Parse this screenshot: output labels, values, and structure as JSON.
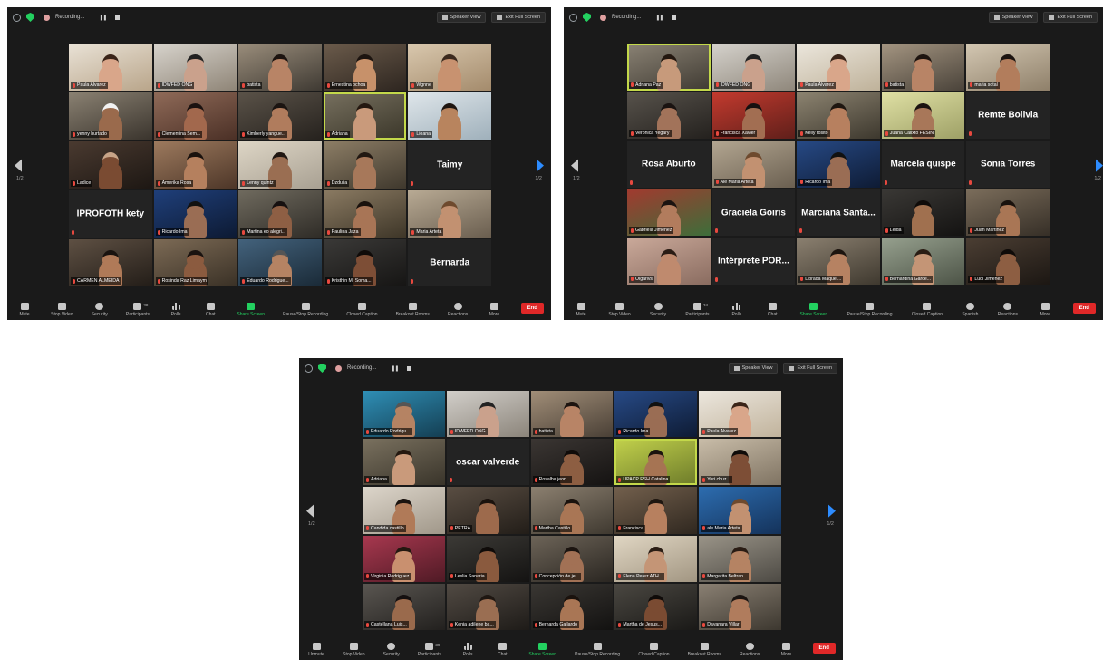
{
  "recording_label": "Recording...",
  "speaker_view_label": "Speaker View",
  "exit_fullscreen_label": "Exit Full Screen",
  "end_label": "End",
  "windows": [
    {
      "page_left": "1/2",
      "page_right": "1/2",
      "tiles": [
        {
          "type": "video",
          "name": "Paula Alvarez",
          "c1": "#e9e2d6",
          "c2": "#b9a58a",
          "skin": "#d9a68a",
          "hair": "#3a2418"
        },
        {
          "type": "video",
          "name": "IDWFED ONG",
          "c1": "#d7d3cc",
          "c2": "#8f8577",
          "skin": "#caa18c",
          "hair": "#222"
        },
        {
          "type": "video",
          "name": "batista",
          "c1": "#9a8d7b",
          "c2": "#3f3a33",
          "skin": "#b88466",
          "hair": "#1d1410"
        },
        {
          "type": "video",
          "name": "Ernestina ochoa",
          "c1": "#6b5b4b",
          "c2": "#2e2620",
          "skin": "#c7916a",
          "hair": "#1c1410"
        },
        {
          "type": "video",
          "name": "Wgnne",
          "c1": "#d9c8ae",
          "c2": "#a48b6c",
          "skin": "#c89270",
          "hair": "#3c2a1e"
        },
        {
          "type": "video",
          "name": "yenny hurtado",
          "c1": "#8a8172",
          "c2": "#3a342d",
          "skin": "#9a6a4c",
          "hair": "#f2f2f2"
        },
        {
          "type": "video",
          "name": "Clementina Sem...",
          "c1": "#8f6a58",
          "c2": "#4b3026",
          "skin": "#a2684d",
          "hair": "#1b1210"
        },
        {
          "type": "video",
          "name": "Kimberly yangue...",
          "c1": "#5a5248",
          "c2": "#26221e",
          "skin": "#b07c5d",
          "hair": "#1b1411"
        },
        {
          "type": "video",
          "name": "Adriana",
          "c1": "#77705f",
          "c2": "#3a3629",
          "skin": "#c99a7b",
          "hair": "#241810",
          "speaking": true
        },
        {
          "type": "video",
          "name": "Lioana",
          "c1": "#dfe6ea",
          "c2": "#9fb0bb",
          "skin": "#b8845e",
          "hair": "#1e1510"
        },
        {
          "type": "video",
          "name": "Ladice",
          "c1": "#4a3a30",
          "c2": "#1d1713",
          "skin": "#7a4b32",
          "hair": "#c7a488"
        },
        {
          "type": "video",
          "name": "Amerika Rosa",
          "c1": "#9d7a5e",
          "c2": "#4d3628",
          "skin": "#b5805e",
          "hair": "#1a120e"
        },
        {
          "type": "video",
          "name": "Lenny quintz",
          "c1": "#ded6c6",
          "c2": "#a8a092",
          "skin": "#9a6e52",
          "hair": "#1f1712"
        },
        {
          "type": "video",
          "name": "Dzdulia",
          "c1": "#8d7e66",
          "c2": "#3f382d",
          "skin": "#a7785a",
          "hair": "#211812"
        },
        {
          "type": "blank",
          "big": "Taimy",
          "name": ""
        },
        {
          "type": "blank",
          "big": "IPROFOTH kety",
          "name": ""
        },
        {
          "type": "video",
          "name": "Ricardo Ima",
          "c1": "#1f3f7a",
          "c2": "#0d1a33",
          "skin": "#9a6d54",
          "hair": "#111"
        },
        {
          "type": "video",
          "name": "Martina eo alegri...",
          "c1": "#6f6a5e",
          "c2": "#2f2c27",
          "skin": "#8e5f44",
          "hair": "#161010"
        },
        {
          "type": "video",
          "name": "Paulina Jaza",
          "c1": "#8a7a62",
          "c2": "#3e3628",
          "skin": "#a87556",
          "hair": "#1a120d"
        },
        {
          "type": "video",
          "name": "Maria Arteta",
          "c1": "#b8aa94",
          "c2": "#6a5e4f",
          "skin": "#c29171",
          "hair": "#6e4a2e"
        },
        {
          "type": "video",
          "name": "CARMEN ALMEIDA",
          "c1": "#5e5043",
          "c2": "#231d18",
          "skin": "#b07a58",
          "hair": "#1a130f"
        },
        {
          "type": "video",
          "name": "Rosinda Raz Limaym",
          "c1": "#7c6a55",
          "c2": "#3a3126",
          "skin": "#8b5b3f",
          "hair": "#1a1310"
        },
        {
          "type": "video",
          "name": "Eduardo Rodrigue...",
          "c1": "#43627c",
          "c2": "#1a2a37",
          "skin": "#b58363",
          "hair": "#555"
        },
        {
          "type": "video",
          "name": "Kristhin M. Soma...",
          "c1": "#3a3937",
          "c2": "#161514",
          "skin": "#7d4e36",
          "hair": "#0f0b09"
        },
        {
          "type": "blank",
          "big": "Bernarda",
          "name": ""
        }
      ],
      "toolbar": [
        {
          "label": "Mute",
          "icon": "mic-icon"
        },
        {
          "label": "Stop Video",
          "icon": "camera-icon"
        },
        {
          "label": "Security",
          "icon": "shield-icon"
        },
        {
          "label": "Participants",
          "icon": "participants-icon",
          "count": "38"
        },
        {
          "label": "Polls",
          "icon": "polls-icon"
        },
        {
          "label": "Chat",
          "icon": "chat-icon"
        },
        {
          "label": "Share Screen",
          "icon": "share-screen-icon",
          "accent": true
        },
        {
          "label": "Pause/Stop Recording",
          "icon": "pause-stop-icon"
        },
        {
          "label": "Closed Caption",
          "icon": "cc-icon"
        },
        {
          "label": "Breakout Rooms",
          "icon": "breakout-icon"
        },
        {
          "label": "Reactions",
          "icon": "reactions-icon"
        },
        {
          "label": "More",
          "icon": "more-icon"
        }
      ]
    },
    {
      "page_left": "1/2",
      "page_right": "1/2",
      "tiles": [
        {
          "type": "video",
          "name": "Adriana Paz",
          "c1": "#8a8274",
          "c2": "#3f3a32",
          "skin": "#c79a7b",
          "hair": "#23170f",
          "speaking": true
        },
        {
          "type": "video",
          "name": "IDWFED ONG",
          "c1": "#d5d2cc",
          "c2": "#8f877b",
          "skin": "#caa18c",
          "hair": "#222"
        },
        {
          "type": "video",
          "name": "Paula Alvarez",
          "c1": "#ebe6dc",
          "c2": "#bfb29a",
          "skin": "#d9a68a",
          "hair": "#3a2418"
        },
        {
          "type": "video",
          "name": "batista",
          "c1": "#a49581",
          "c2": "#4a433a",
          "skin": "#b88466",
          "hair": "#1d1410"
        },
        {
          "type": "video",
          "name": "maria sotal",
          "c1": "#d3c7b2",
          "c2": "#8f806a",
          "skin": "#b27d5c",
          "hair": "#1c1410"
        },
        {
          "type": "video",
          "name": "Veronica Yegary",
          "c1": "#57524b",
          "c2": "#24211e",
          "skin": "#a2735a",
          "hair": "#1a1311"
        },
        {
          "type": "video",
          "name": "Francisca Xavier",
          "c1": "#c33a2e",
          "c2": "#5f1f1a",
          "skin": "#a26e52",
          "hair": "#151010"
        },
        {
          "type": "video",
          "name": "Kelly rosito",
          "c1": "#8c8370",
          "c2": "#3d382e",
          "skin": "#b7805f",
          "hair": "#1e1610"
        },
        {
          "type": "video",
          "name": "Juana Calixto FESIN",
          "c1": "#dfe0a4",
          "c2": "#9ea066",
          "skin": "#a87759",
          "hair": "#1b1310"
        },
        {
          "type": "blank",
          "big": "Remte Bolivia",
          "name": ""
        },
        {
          "type": "blank",
          "big": "Rosa Aburto",
          "name": ""
        },
        {
          "type": "video",
          "name": "Ale Maria Arteta",
          "c1": "#b4a792",
          "c2": "#6a5f50",
          "skin": "#c29171",
          "hair": "#6e4a2e"
        },
        {
          "type": "video",
          "name": "Ricardo Ima",
          "c1": "#274a86",
          "c2": "#0e1b34",
          "skin": "#9a6d54",
          "hair": "#111"
        },
        {
          "type": "blank",
          "big": "Marcela quispe",
          "name": ""
        },
        {
          "type": "blank",
          "big": "Sonia Torres",
          "name": ""
        },
        {
          "type": "video",
          "name": "Gabriela Jimenez",
          "c1": "#a13a2f",
          "c2": "#3d6e3a",
          "skin": "#b27c5d",
          "hair": "#1b1310"
        },
        {
          "type": "blank",
          "big": "Graciela Goiris",
          "name": ""
        },
        {
          "type": "blank",
          "big": "Marciana Santa...",
          "name": ""
        },
        {
          "type": "video",
          "name": "Leida",
          "c1": "#3a3835",
          "c2": "#141312",
          "skin": "#a0704f",
          "hair": "#0f0b09"
        },
        {
          "type": "video",
          "name": "Juan Martinez",
          "c1": "#7b6d5b",
          "c2": "#362f27",
          "skin": "#a97655",
          "hair": "#1a120d"
        },
        {
          "type": "video",
          "name": "Olgarivs",
          "c1": "#caa99a",
          "c2": "#8a6c60",
          "skin": "#bf8a6e",
          "hair": "#2a1c14"
        },
        {
          "type": "blank",
          "big": "Intérprete POR...",
          "name": ""
        },
        {
          "type": "video",
          "name": "Librada Maquel...",
          "c1": "#8b8070",
          "c2": "#3f392f",
          "skin": "#b68262",
          "hair": "#1c140f"
        },
        {
          "type": "video",
          "name": "Bernardina Garce...",
          "c1": "#96a08e",
          "c2": "#4d5447",
          "skin": "#c49576",
          "hair": "#2a1d14"
        },
        {
          "type": "video",
          "name": "Ludi Jimenez",
          "c1": "#4b3e33",
          "c2": "#1c1713",
          "skin": "#8d5e42",
          "hair": "#0f0b09"
        }
      ],
      "toolbar": [
        {
          "label": "Mute",
          "icon": "mic-icon"
        },
        {
          "label": "Stop Video",
          "icon": "camera-icon"
        },
        {
          "label": "Security",
          "icon": "shield-icon"
        },
        {
          "label": "Participants",
          "icon": "participants-icon",
          "count": "34"
        },
        {
          "label": "Polls",
          "icon": "polls-icon"
        },
        {
          "label": "Chat",
          "icon": "chat-icon"
        },
        {
          "label": "Share Screen",
          "icon": "share-screen-icon",
          "accent": true
        },
        {
          "label": "Pause/Stop Recording",
          "icon": "pause-stop-icon"
        },
        {
          "label": "Closed Caption",
          "icon": "cc-icon"
        },
        {
          "label": "Spanish",
          "icon": "language-icon"
        },
        {
          "label": "Reactions",
          "icon": "reactions-icon"
        },
        {
          "label": "More",
          "icon": "more-icon"
        }
      ]
    },
    {
      "page_left": "1/2",
      "page_right": "1/2",
      "tiles": [
        {
          "type": "video",
          "name": "Eduardo Rodrigu...",
          "c1": "#2f8fb6",
          "c2": "#143e52",
          "skin": "#b58363",
          "hair": "#555"
        },
        {
          "type": "video",
          "name": "IDWFED ONG",
          "c1": "#d2cfca",
          "c2": "#8b847a",
          "skin": "#caa18c",
          "hair": "#222"
        },
        {
          "type": "video",
          "name": "batista",
          "c1": "#a18e78",
          "c2": "#4a4036",
          "skin": "#b88466",
          "hair": "#1d1410"
        },
        {
          "type": "video",
          "name": "Ricardo Ima",
          "c1": "#274a86",
          "c2": "#0e1b34",
          "skin": "#9a6d54",
          "hair": "#111"
        },
        {
          "type": "video",
          "name": "Paula Alvarez",
          "c1": "#ece7de",
          "c2": "#c1b39c",
          "skin": "#d9a68a",
          "hair": "#3a2418"
        },
        {
          "type": "video",
          "name": "Adriana",
          "c1": "#7a715f",
          "c2": "#39342a",
          "skin": "#c99a7b",
          "hair": "#241810"
        },
        {
          "type": "blank",
          "big": "oscar valverde",
          "name": ""
        },
        {
          "type": "video",
          "name": "Rosalba jeon...",
          "c1": "#3b3633",
          "c2": "#151312",
          "skin": "#8d5e42",
          "hair": "#0f0b09"
        },
        {
          "type": "video",
          "name": "UPACP ESH Catalina",
          "c1": "#c3d24c",
          "c2": "#6d7b2a",
          "skin": "#a67453",
          "hair": "#1b130e",
          "speaking": true
        },
        {
          "type": "video",
          "name": "Yuri chuz...",
          "c1": "#c9bda9",
          "c2": "#7f7362",
          "skin": "#7d4e36",
          "hair": "#0f0b09"
        },
        {
          "type": "video",
          "name": "Candida castillo",
          "c1": "#ddd6cb",
          "c2": "#a09789",
          "skin": "#b07a58",
          "hair": "#1a130f"
        },
        {
          "type": "video",
          "name": "PETRA",
          "c1": "#5a4e43",
          "c2": "#221d18",
          "skin": "#9d6a4c",
          "hair": "#1a120d"
        },
        {
          "type": "video",
          "name": "Martha Castillo",
          "c1": "#8c8070",
          "c2": "#3f3930",
          "skin": "#a97655",
          "hair": "#1a120d"
        },
        {
          "type": "video",
          "name": "Francisca",
          "c1": "#73604d",
          "c2": "#2f271f",
          "skin": "#b7805f",
          "hair": "#1e1610"
        },
        {
          "type": "video",
          "name": "ale Maria Arteta",
          "c1": "#2d6db0",
          "c2": "#14325a",
          "skin": "#c29171",
          "hair": "#6e4a2e"
        },
        {
          "type": "video",
          "name": "Virginia Rodriguez",
          "c1": "#a8384f",
          "c2": "#4f1a25",
          "skin": "#c9906f",
          "hair": "#241810"
        },
        {
          "type": "video",
          "name": "Leslia Sanaria",
          "c1": "#3c3a36",
          "c2": "#141312",
          "skin": "#8a5a3e",
          "hair": "#0f0b09"
        },
        {
          "type": "video",
          "name": "Concepción de je...",
          "c1": "#6d6458",
          "c2": "#2a2621",
          "skin": "#a27155",
          "hair": "#1b1410"
        },
        {
          "type": "video",
          "name": "Elena Perez ATH...",
          "c1": "#e0d6c3",
          "c2": "#a29682",
          "skin": "#c49576",
          "hair": "#2a1d14"
        },
        {
          "type": "video",
          "name": "Margarita Beltran...",
          "c1": "#9a9488",
          "c2": "#4d4a44",
          "skin": "#b58363",
          "hair": "#2a1c14"
        },
        {
          "type": "video",
          "name": "Castellana Luis...",
          "c1": "#5a5651",
          "c2": "#22201e",
          "skin": "#9a6a4c",
          "hair": "#151010"
        },
        {
          "type": "video",
          "name": "Kenia adilene ba...",
          "c1": "#514a43",
          "c2": "#1e1b18",
          "skin": "#9a6e52",
          "hair": "#1f1712"
        },
        {
          "type": "video",
          "name": "Bernarda Gallardo",
          "c1": "#3a3733",
          "c2": "#131211",
          "skin": "#a97655",
          "hair": "#1a120d"
        },
        {
          "type": "video",
          "name": "Martha de Jesus...",
          "c1": "#4a4741",
          "c2": "#1a1917",
          "skin": "#7a4b32",
          "hair": "#0f0b09"
        },
        {
          "type": "video",
          "name": "Dayanara Villar",
          "c1": "#8a8073",
          "c2": "#3c372f",
          "skin": "#b07c5d",
          "hair": "#1b1411"
        }
      ],
      "toolbar": [
        {
          "label": "Unmute",
          "icon": "mic-off-icon"
        },
        {
          "label": "Stop Video",
          "icon": "camera-icon"
        },
        {
          "label": "Security",
          "icon": "shield-icon"
        },
        {
          "label": "Participants",
          "icon": "participants-icon",
          "count": "39"
        },
        {
          "label": "Polls",
          "icon": "polls-icon"
        },
        {
          "label": "Chat",
          "icon": "chat-icon"
        },
        {
          "label": "Share Screen",
          "icon": "share-screen-icon",
          "accent": true
        },
        {
          "label": "Pause/Stop Recording",
          "icon": "pause-stop-icon"
        },
        {
          "label": "Closed Caption",
          "icon": "cc-icon"
        },
        {
          "label": "Breakout Rooms",
          "icon": "breakout-icon"
        },
        {
          "label": "Reactions",
          "icon": "reactions-icon"
        },
        {
          "label": "More",
          "icon": "more-icon"
        }
      ]
    }
  ],
  "colors": {
    "window_bg": "#1a1a1a",
    "tile_blank": "#232323",
    "speaking_outline": "#c3d84a",
    "share_accent": "#23d160",
    "end_red": "#e02828",
    "arrow_blue": "#2d8cff",
    "mic_off_red": "#e8493f"
  }
}
